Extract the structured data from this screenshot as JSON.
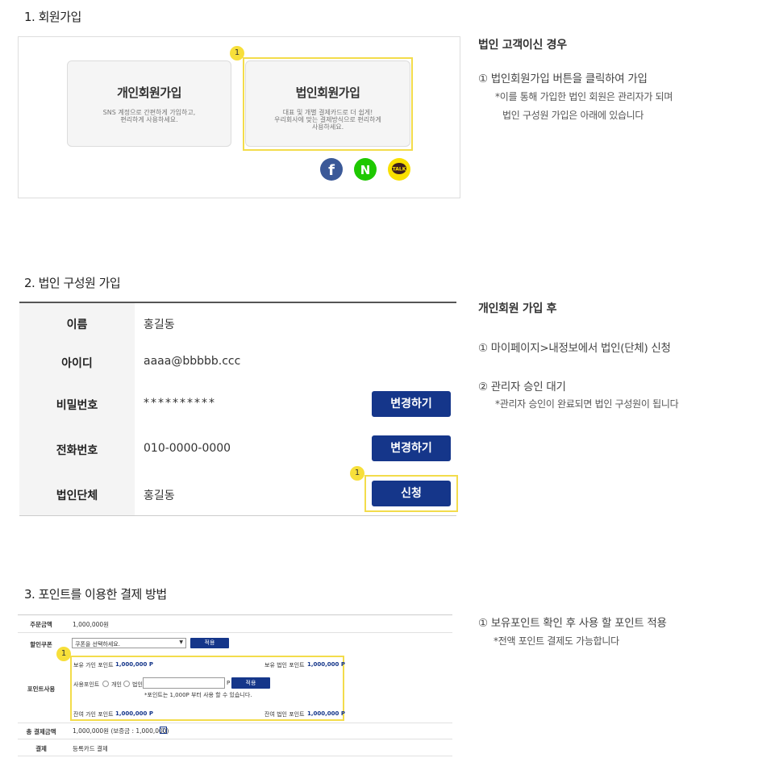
{
  "section1": {
    "title": "1. 회원가입",
    "card_personal": {
      "title": "개인회원가입",
      "desc": "SNS 계정으로 간편하게 가입하고,\n편리하게 사용하세요."
    },
    "card_corporate": {
      "title": "법인회원가입",
      "desc": "대표 및 개별 결제카드로 더 쉽게!\n우리회사에 맞는 결제방식으로 편리하게\n사용하세요."
    },
    "badge": "1",
    "social": [
      {
        "icon": "facebook-icon",
        "glyph": "f",
        "color": "#3b5998"
      },
      {
        "icon": "naver-icon",
        "glyph": "N",
        "color": "#1ec800"
      },
      {
        "icon": "kakaotalk-icon",
        "glyph": "TALK",
        "color": "#f9e000"
      }
    ],
    "note": {
      "head": "법인 고객이신 경우",
      "line1": "① 법인회원가입 버튼을 클릭하여 가입",
      "line2": "*이를 통해 가입한 법인 회원은 관리자가 되며",
      "line3": "법인 구성원 가입은 아래에 있습니다"
    }
  },
  "section2": {
    "title": "2. 법인 구성원 가입",
    "rows": [
      {
        "label": "이름",
        "value": "홍길동"
      },
      {
        "label": "아이디",
        "value": "aaaa@bbbbb.ccc"
      },
      {
        "label": "비밀번호",
        "value": "**********",
        "button": "변경하기"
      },
      {
        "label": "전화번호",
        "value": "010-0000-0000",
        "button": "변경하기"
      },
      {
        "label": "법인단체",
        "value": "홍길동",
        "button": "신청"
      }
    ],
    "badge": "1",
    "note": {
      "head": "개인회원 가입 후",
      "line1": "① 마이페이지>내정보에서 법인(단체) 신청",
      "line2": "② 관리자 승인 대기",
      "line3": "*관리자 승인이 완료되면 법인 구성원이 됩니다"
    }
  },
  "section3": {
    "title": "3. 포인트를 이용한 결제 방법",
    "order_label": "주문금액",
    "order_value": "1,000,000원",
    "coupon_label": "할인쿠폰",
    "coupon_select": "쿠폰을 선택하세요.",
    "apply": "적용",
    "personal_point": "보유 가인 포인트",
    "personal_point_value": "1,000,000 P",
    "corporate_point": "보유 법인 포인트",
    "corporate_point_value": "1,000,000 P",
    "point_label": "포인트사용",
    "use_point": "사용포인트",
    "radio_personal": "개인",
    "radio_corporate": "법인",
    "point_unit": "P",
    "point_hint": "*포인트는 1,000P 부터 사용 할 수 있습니다.",
    "remain_personal": "잔여 가인 포인트",
    "remain_personal_value": "1,000,000 P",
    "remain_corporate": "잔여 법인 포인트",
    "remain_corporate_value": "1,000,000 P",
    "total_label": "총 결제금액",
    "total_value": "1,000,000원 (보증금 : 1,000,000)",
    "help": "?",
    "pay_label": "결제",
    "pay_value": "등록카드 결제",
    "badge": "1",
    "note": {
      "line1": "① 보유포인트 확인 후 사용 할 포인트 적용",
      "line2": "*전액 포인트 결제도 가능합니다"
    }
  }
}
